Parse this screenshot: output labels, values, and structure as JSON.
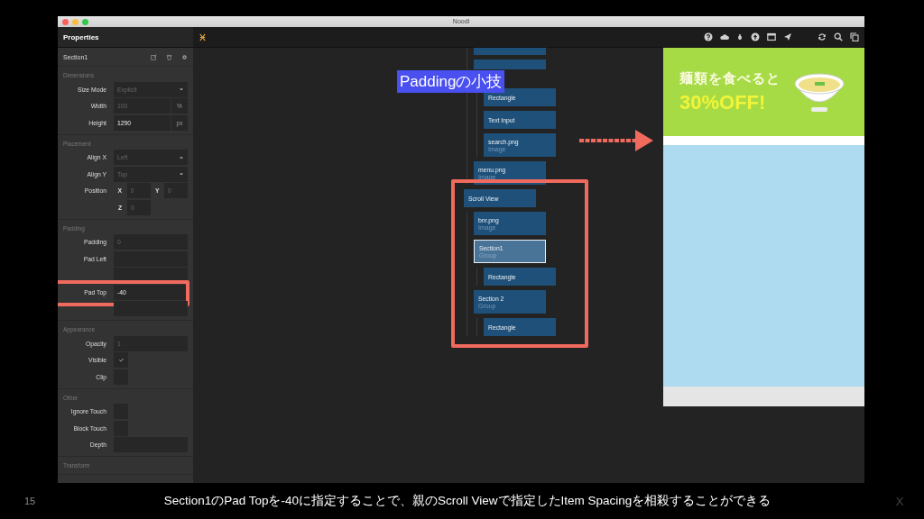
{
  "window": {
    "title": "Noodl"
  },
  "properties": {
    "title": "Properties",
    "node_name": "Section1",
    "sections": [
      {
        "heading": "Dimensions",
        "rows": [
          {
            "kind": "dropdown",
            "label": "Size Mode",
            "placeholder": "Explicit"
          },
          {
            "kind": "number",
            "label": "Width",
            "placeholder": "100",
            "unit": "%"
          },
          {
            "kind": "number",
            "label": "Height",
            "value": "1290",
            "unit": "px"
          }
        ]
      },
      {
        "heading": "Placement",
        "rows": [
          {
            "kind": "dropdown",
            "label": "Align X",
            "placeholder": "Left"
          },
          {
            "kind": "dropdown",
            "label": "Align Y",
            "placeholder": "Top"
          },
          {
            "kind": "coords",
            "label": "Position",
            "fields": [
              {
                "axis": "X",
                "placeholder": "0"
              },
              {
                "axis": "Y",
                "placeholder": "0"
              }
            ]
          },
          {
            "kind": "coords",
            "fields": [
              {
                "axis": "Z",
                "placeholder": "0"
              }
            ]
          }
        ]
      },
      {
        "heading": "Padding",
        "rows": [
          {
            "kind": "number",
            "label": "Padding",
            "placeholder": "0"
          },
          {
            "kind": "number",
            "label": "Pad Left"
          },
          {
            "kind": "number"
          },
          {
            "kind": "number",
            "label": "Pad Top",
            "value": "-40",
            "highlighted": true
          },
          {
            "kind": "number"
          }
        ]
      },
      {
        "heading": "Appearance",
        "rows": [
          {
            "kind": "number",
            "label": "Opacity",
            "placeholder": "1"
          },
          {
            "kind": "checkbox",
            "label": "Visible",
            "checked": true
          },
          {
            "kind": "checkbox",
            "label": "Clip",
            "checked": false
          }
        ]
      },
      {
        "heading": "Other",
        "rows": [
          {
            "kind": "checkbox",
            "label": "Ignore Touch",
            "checked": false
          },
          {
            "kind": "checkbox",
            "label": "Block Touch",
            "checked": false
          },
          {
            "kind": "number",
            "label": "Depth"
          }
        ]
      },
      {
        "heading": "Transform"
      }
    ]
  },
  "canvas": {
    "annotation": "Paddingの小技",
    "nodes": [
      {
        "kind": "branch",
        "children": [
          {
            "kind": "node",
            "selected": false
          },
          {
            "kind": "covered",
            "selected": false,
            "children": [
              {
                "kind": "node",
                "title": "Rectangle",
                "selected": false
              },
              {
                "kind": "node",
                "title": "Text Input",
                "selected": false
              },
              {
                "kind": "node",
                "title": "search.png",
                "subtitle": "Image",
                "selected": false
              }
            ]
          },
          {
            "kind": "node",
            "title": "menu.png",
            "subtitle": "Image",
            "selected": false
          }
        ]
      },
      {
        "kind": "node",
        "title": "Scroll View",
        "highlighted": true,
        "selected": false,
        "children": [
          {
            "kind": "node",
            "title": "bnr.png",
            "subtitle": "Image",
            "selected": false
          },
          {
            "kind": "node",
            "title": "Section1",
            "subtitle": "Group",
            "selected": true,
            "children": [
              {
                "kind": "node",
                "title": "Rectangle",
                "selected": false
              }
            ]
          },
          {
            "kind": "node",
            "title": "Section 2",
            "subtitle": "Group",
            "selected": false,
            "children": [
              {
                "kind": "node",
                "title": "Rectangle",
                "selected": false
              }
            ]
          }
        ]
      }
    ]
  },
  "preview": {
    "banner_text": "麺類を食べると",
    "banner_offer": "30%OFF!"
  },
  "slide": {
    "number": "15",
    "caption": "Section1のPad Topを-40に指定することで、親のScroll Viewで指定したItem Spacingを相殺することができる",
    "mark": "X"
  }
}
